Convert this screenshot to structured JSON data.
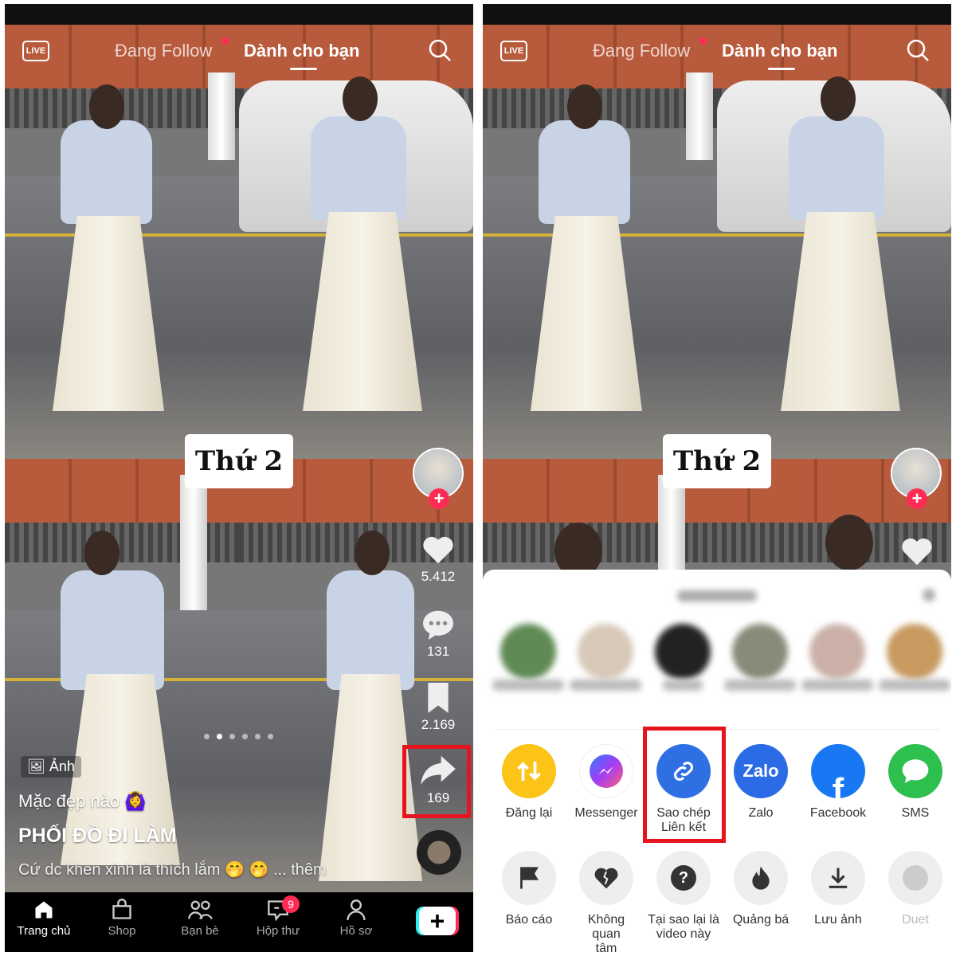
{
  "header": {
    "live_label": "LIVE",
    "following_tab": "Đang Follow",
    "for_you_tab": "Dành cho bạn"
  },
  "post": {
    "day_label": "Thứ 2",
    "likes": "5.412",
    "comments": "131",
    "bookmarks": "2.169",
    "shares": "169",
    "media_type": "Ảnh",
    "title_line": "Mặc đẹp nào 🙆‍♀️",
    "headline": "PHỐI ĐỒ ĐI LÀM",
    "description": "Cứ dc khen xinh là thích lắm 🤭 🤭",
    "more": "... thêm",
    "slides_total": 6,
    "slide_active": 2
  },
  "nav": {
    "items": [
      {
        "label": "Trang chủ"
      },
      {
        "label": "Shop"
      },
      {
        "label": "Bạn bè"
      },
      {
        "label": "Hộp thư",
        "badge": "9"
      },
      {
        "label": "Hồ sơ"
      }
    ],
    "create": "+"
  },
  "share_sheet": {
    "apps": [
      {
        "label": "Đăng lại",
        "color": "#fcc419"
      },
      {
        "label": "Messenger",
        "color": "#ffffff"
      },
      {
        "label": "Sao chép Liên kết",
        "color": "#2f6fe4"
      },
      {
        "label": "Zalo",
        "color": "#2b6be6"
      },
      {
        "label": "Facebook",
        "color": "#1877f2"
      },
      {
        "label": "SMS",
        "color": "#2ec04f"
      }
    ],
    "zalo_logo": "Zalo",
    "actions": [
      {
        "label": "Báo cáo"
      },
      {
        "label": "Không quan tâm"
      },
      {
        "label": "Tại sao lại là video này"
      },
      {
        "label": "Quảng bá"
      },
      {
        "label": "Lưu ảnh"
      },
      {
        "label": "Duet"
      }
    ]
  },
  "colors": {
    "accent": "#fe2c55",
    "highlight": "#e5141e"
  }
}
